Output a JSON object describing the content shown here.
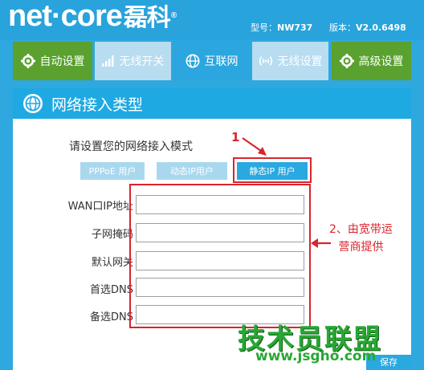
{
  "header": {
    "logo_text": "net·core",
    "logo_cn": "磊科",
    "logo_reg": "®",
    "model_label": "型号：",
    "model_value": "NW737",
    "version_label": "版本：",
    "version_value": "V2.0.6498"
  },
  "nav": {
    "tabs": [
      {
        "label": "自动设置",
        "icon": "gear-icon"
      },
      {
        "label": "无线开关",
        "icon": "signal-bars-icon"
      },
      {
        "label": "互联网",
        "icon": "globe-icon"
      },
      {
        "label": "无线设置",
        "icon": "wifi-icon"
      },
      {
        "label": "高级设置",
        "icon": "gear-icon"
      }
    ]
  },
  "panel": {
    "title": "网络接入类型",
    "prompt": "请设置您的网络接入模式",
    "modes": [
      "PPPoE 用户",
      "动态IP用户",
      "静态IP 用户"
    ],
    "active_mode": "静态IP 用户",
    "fields": [
      {
        "label": "WAN口IP地址",
        "value": ""
      },
      {
        "label": "子网掩码",
        "value": ""
      },
      {
        "label": "默认网关",
        "value": ""
      },
      {
        "label": "首选DNS",
        "value": ""
      },
      {
        "label": "备选DNS",
        "value": ""
      }
    ],
    "corner_button": "保存"
  },
  "annotations": {
    "marker_1": "1",
    "note_line1": "2、由宽带运",
    "note_line2": "营商提供"
  },
  "watermark": {
    "text": "技术员联盟",
    "url": "www.jsgho.com"
  },
  "colors": {
    "background": "#2ea8df",
    "active_tab": "#5aa12f",
    "highlight": "#d9252d",
    "watermark": "#27a833"
  }
}
